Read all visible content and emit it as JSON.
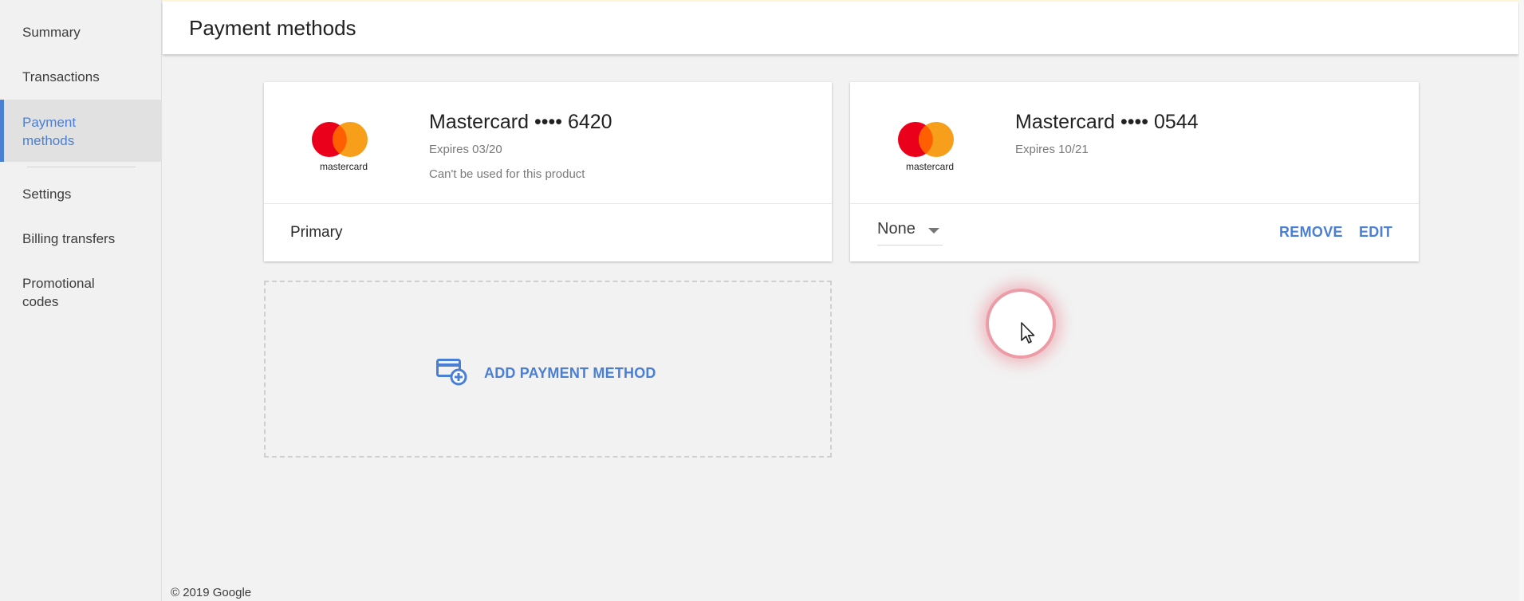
{
  "sidebar": {
    "items": [
      {
        "label": "Summary"
      },
      {
        "label": "Transactions"
      },
      {
        "label": "Payment methods"
      },
      {
        "label": "Settings"
      },
      {
        "label": "Billing transfers"
      },
      {
        "label": "Promotional codes"
      }
    ],
    "active_index": 2
  },
  "header": {
    "title": "Payment methods"
  },
  "cards": [
    {
      "logo_text": "mastercard",
      "title": "Mastercard •••• 6420",
      "expires": "Expires 03/20",
      "note": "Can't be used for this product",
      "footer_label": "Primary"
    },
    {
      "logo_text": "mastercard",
      "title": "Mastercard •••• 0544",
      "expires": "Expires 10/21",
      "select_value": "None",
      "remove_label": "REMOVE",
      "edit_label": "EDIT"
    }
  ],
  "add_payment": {
    "label": "ADD PAYMENT METHOD",
    "icon": "add-card-icon"
  },
  "footer": {
    "copyright": "© 2019 Google"
  },
  "colors": {
    "accent": "#4a7fd6",
    "mc_red": "#eb001b",
    "mc_orange": "#f79e1b",
    "mc_overlap": "#ff5f00"
  }
}
